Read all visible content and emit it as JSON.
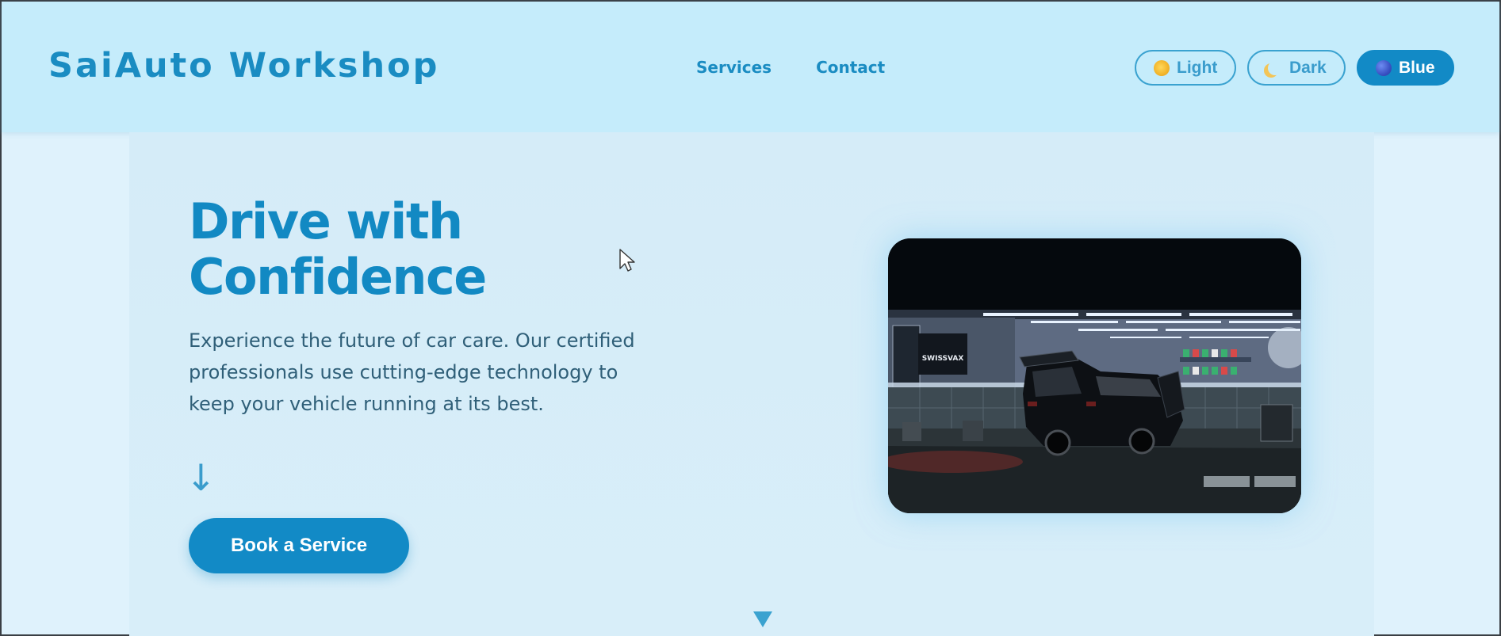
{
  "header": {
    "brand": "SaiAuto Workshop",
    "nav": {
      "services": "Services",
      "contact": "Contact"
    },
    "themes": {
      "light": {
        "label": "Light",
        "icon": "sun-icon"
      },
      "dark": {
        "label": "Dark",
        "icon": "moon-icon"
      },
      "blue": {
        "label": "Blue",
        "icon": "globe-icon",
        "active": true
      }
    }
  },
  "hero": {
    "title_line1": "Drive with",
    "title_line2": "Confidence",
    "description": "Experience the future of car care. Our certified professionals use cutting-edge technology to keep your vehicle running at its best.",
    "arrow": "↓",
    "cta_label": "Book a Service",
    "image": {
      "subject": "car-in-garage-image",
      "sign_text": "SWISSVAX"
    }
  },
  "colors": {
    "accent": "#128ac6",
    "header_bg": "#c5ecfb",
    "page_bg": "#dff2fc",
    "body_text": "#2f5f78"
  }
}
